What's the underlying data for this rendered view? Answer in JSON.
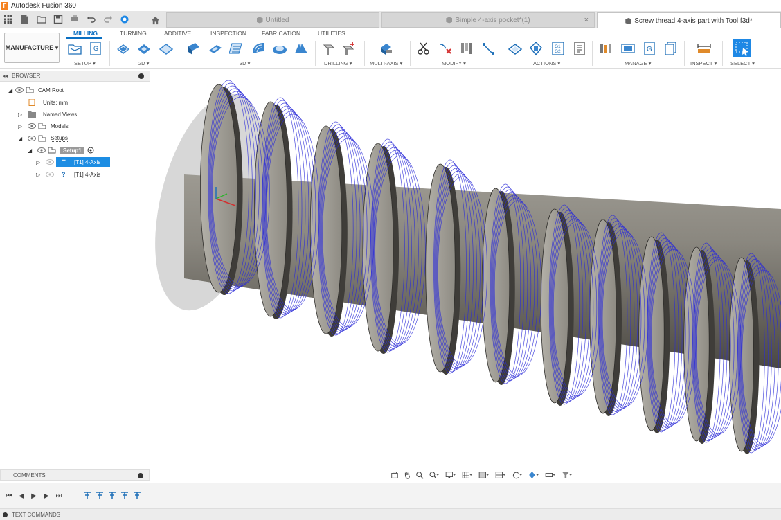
{
  "app": {
    "title": "Autodesk Fusion 360",
    "logo_letter": "F"
  },
  "tabs": [
    {
      "label": "Untitled",
      "active": false
    },
    {
      "label": "Simple 4-axis pocket*(1)",
      "active": false,
      "close": "×"
    },
    {
      "label": "Screw thread 4-axis part with Tool.f3d*",
      "active": true
    }
  ],
  "toolbar": {
    "workspace": "MANUFACTURE ▾",
    "tabs": [
      "MILLING",
      "TURNING",
      "ADDITIVE",
      "INSPECTION",
      "FABRICATION",
      "UTILITIES"
    ],
    "active_tab": "MILLING",
    "groups": [
      "SETUP ▾",
      "2D ▾",
      "3D ▾",
      "DRILLING ▾",
      "MULTI-AXIS ▾",
      "MODIFY ▾",
      "ACTIONS ▾",
      "MANAGE ▾",
      "INSPECT ▾",
      "SELECT ▾"
    ],
    "gcode_icon": "G1\nG2",
    "setup_g_icon": "G"
  },
  "browser": {
    "title": "BROWSER",
    "collapse": "◂◂",
    "tree": [
      {
        "label": "CAM Root",
        "indent": 0,
        "tri": "◢",
        "icon": "component-icon"
      },
      {
        "label": "Units: mm",
        "indent": 1,
        "tri": "",
        "icon": "document-icon"
      },
      {
        "label": "Named Views",
        "indent": 1,
        "tri": "▷",
        "icon": "folder-icon"
      },
      {
        "label": "Models",
        "indent": 1,
        "tri": "▷",
        "icon": "component-icon"
      },
      {
        "label": "Setups",
        "indent": 1,
        "tri": "◢",
        "icon": "component-icon"
      },
      {
        "label": "Setup1",
        "indent": 2,
        "tri": "◢",
        "icon": "setup-icon"
      },
      {
        "label": "[T1] 4-Axis",
        "indent": 3,
        "tri": "▷",
        "icon": "toolpath-icon",
        "selected": true
      },
      {
        "label": "[T1] 4-Axis",
        "indent": 3,
        "tri": "▷",
        "icon": "question-icon"
      }
    ]
  },
  "comments": {
    "title": "COMMENTS"
  },
  "text_commands": {
    "title": "TEXT COMMANDS"
  },
  "colors": {
    "accent": "#0a6fc2",
    "selection": "#1d8de3",
    "toolpath": "#2b2bd8",
    "part": "#7d7a72"
  }
}
